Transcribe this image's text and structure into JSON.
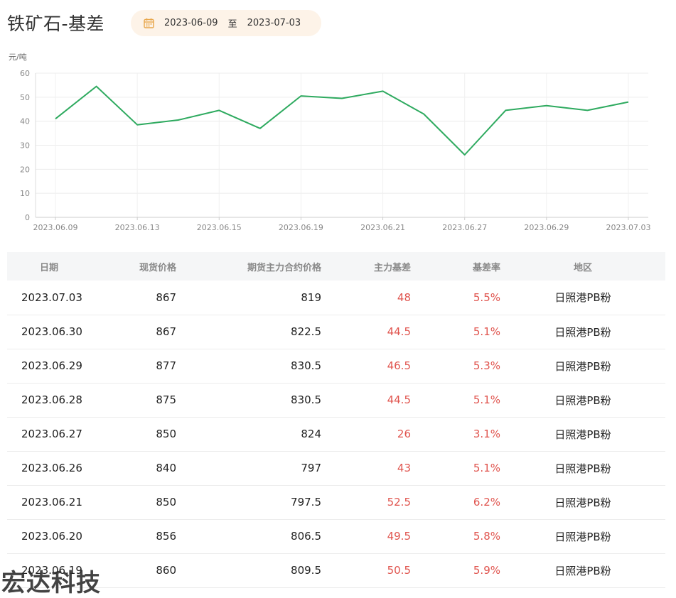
{
  "header": {
    "title": "铁矿石-基差",
    "date_start": "2023-06-09",
    "date_separator": "至",
    "date_end": "2023-07-03"
  },
  "chart_data": {
    "type": "line",
    "ylabel": "元/吨",
    "ylim": [
      0,
      60
    ],
    "yticks": [
      0,
      10,
      20,
      30,
      40,
      50,
      60
    ],
    "x": [
      "2023.06.09",
      "2023.06.12",
      "2023.06.13",
      "2023.06.14",
      "2023.06.15",
      "2023.06.16",
      "2023.06.19",
      "2023.06.20",
      "2023.06.21",
      "2023.06.26",
      "2023.06.27",
      "2023.06.28",
      "2023.06.29",
      "2023.06.30",
      "2023.07.03"
    ],
    "xtick_labels": [
      "2023.06.09",
      "2023.06.13",
      "2023.06.15",
      "2023.06.19",
      "2023.06.21",
      "2023.06.27",
      "2023.06.29",
      "2023.07.03"
    ],
    "series": [
      {
        "values": [
          41,
          54.5,
          38.5,
          40.5,
          44.5,
          37,
          50.5,
          49.5,
          52.5,
          43,
          26,
          44.5,
          46.5,
          44.5,
          48
        ]
      }
    ],
    "line_color": "#2eaa5f",
    "grid": true
  },
  "table": {
    "headers": [
      "日期",
      "现货价格",
      "期货主力合约价格",
      "主力基差",
      "基差率",
      "地区"
    ],
    "rows": [
      [
        "2023.07.03",
        "867",
        "819",
        "48",
        "5.5%",
        "日照港PB粉"
      ],
      [
        "2023.06.30",
        "867",
        "822.5",
        "44.5",
        "5.1%",
        "日照港PB粉"
      ],
      [
        "2023.06.29",
        "877",
        "830.5",
        "46.5",
        "5.3%",
        "日照港PB粉"
      ],
      [
        "2023.06.28",
        "875",
        "830.5",
        "44.5",
        "5.1%",
        "日照港PB粉"
      ],
      [
        "2023.06.27",
        "850",
        "824",
        "26",
        "3.1%",
        "日照港PB粉"
      ],
      [
        "2023.06.26",
        "840",
        "797",
        "43",
        "5.1%",
        "日照港PB粉"
      ],
      [
        "2023.06.21",
        "850",
        "797.5",
        "52.5",
        "6.2%",
        "日照港PB粉"
      ],
      [
        "2023.06.20",
        "856",
        "806.5",
        "49.5",
        "5.8%",
        "日照港PB粉"
      ],
      [
        "2023.06.19",
        "860",
        "809.5",
        "50.5",
        "5.9%",
        "日照港PB粉"
      ]
    ],
    "highlight_color": "#e0544e"
  },
  "watermark": "宏达科技"
}
